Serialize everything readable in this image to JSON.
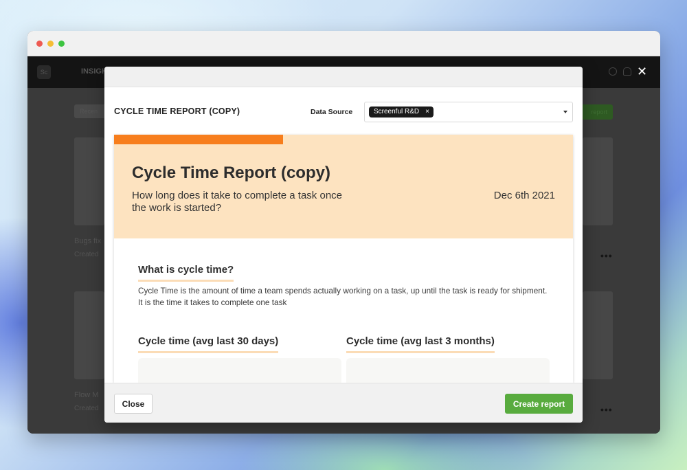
{
  "window": {
    "close_glyph": "✕"
  },
  "background_app": {
    "logo_text": "Sc",
    "nav_label": "INSIGH",
    "recent_chip": "Recen",
    "new_button": "report",
    "card1_title": "Bugs fix",
    "card1_meta": "Created",
    "card2_title": "Flow M",
    "card2_meta": "Created",
    "more_glyph": "•••"
  },
  "modal": {
    "title": "CYCLE TIME REPORT (COPY)",
    "data_source_label": "Data Source",
    "data_source_tag": "Screenful R&D",
    "tag_remove_glyph": "×"
  },
  "report": {
    "title": "Cycle Time Report (copy)",
    "subtitle": "How long does it take to complete a task once the work is started?",
    "date": "Dec 6th 2021",
    "section_heading": "What is cycle time?",
    "section_body": "Cycle Time is the amount of time a team spends actually working on a task, up until the task is ready for shipment. It is the time it takes to complete one task",
    "chart1_heading": "Cycle time (avg last 30 days)",
    "chart2_heading": "Cycle time (avg last 3 months)"
  },
  "footer": {
    "close_label": "Close",
    "create_label": "Create report"
  },
  "colors": {
    "accent_orange": "#f77e1d",
    "hero_bg": "#fde3c0",
    "create_green": "#58ab3e"
  }
}
